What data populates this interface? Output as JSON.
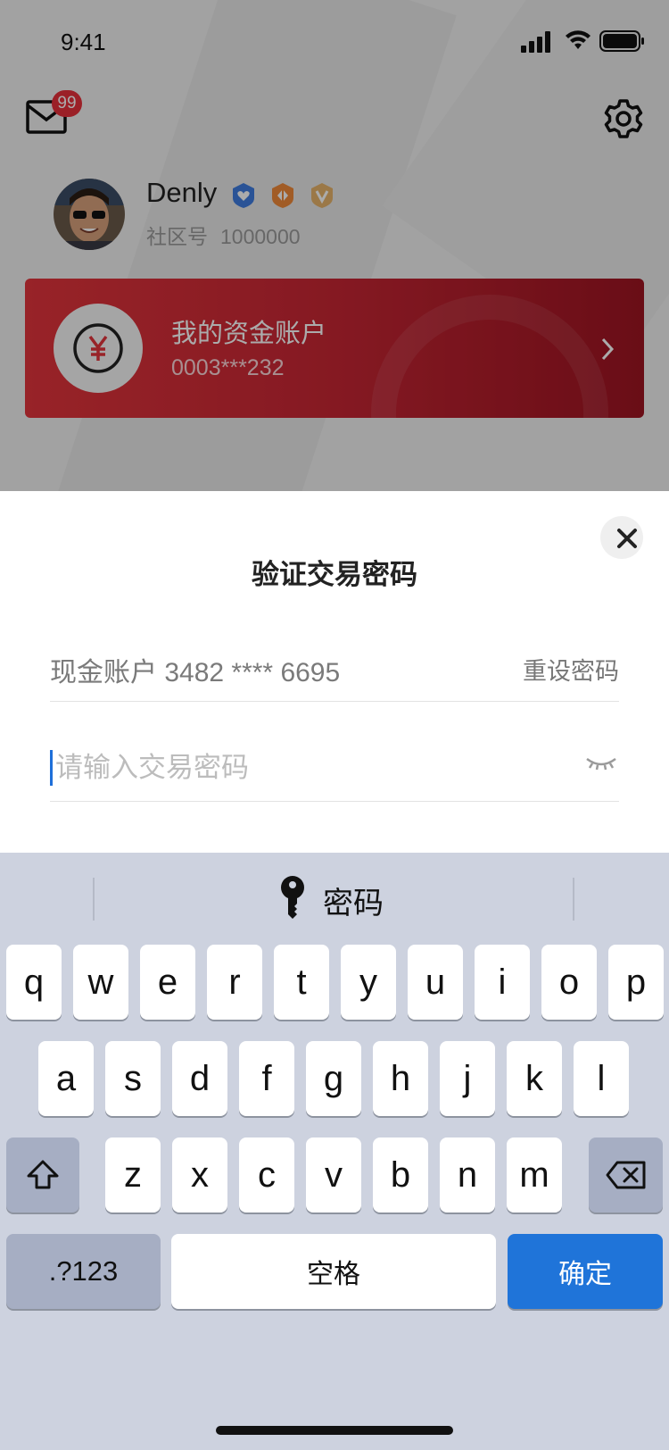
{
  "status_bar": {
    "time": "9:41"
  },
  "header": {
    "mail_badge": "99",
    "mail_icon": "mail-icon",
    "settings_icon": "gear-icon"
  },
  "profile": {
    "name": "Denly",
    "community_label": "社区号",
    "community_number": "1000000",
    "badges": [
      "blue-heart-shield-badge",
      "orange-diamond-shield-badge",
      "gold-v-shield-badge"
    ]
  },
  "account_card": {
    "title": "我的资金账户",
    "account_number": "0003***232",
    "icon": "yuan-coin-icon"
  },
  "password_sheet": {
    "title": "验证交易密码",
    "account_label": "现金账户 3482 **** 6695",
    "reset_link": "重设密码",
    "input_placeholder": "请输入交易密码",
    "input_value": ""
  },
  "keyboard": {
    "suggestion": "密码",
    "row1": [
      "q",
      "w",
      "e",
      "r",
      "t",
      "y",
      "u",
      "i",
      "o",
      "p"
    ],
    "row2": [
      "a",
      "s",
      "d",
      "f",
      "g",
      "h",
      "j",
      "k",
      "l"
    ],
    "row3": [
      "z",
      "x",
      "c",
      "v",
      "b",
      "n",
      "m"
    ],
    "symbols_key": ".?123",
    "space_key": "空格",
    "confirm_key": "确定"
  },
  "colors": {
    "accent_blue": "#1f74d9",
    "card_red": "#c72634",
    "badge_red": "#e8313b"
  }
}
